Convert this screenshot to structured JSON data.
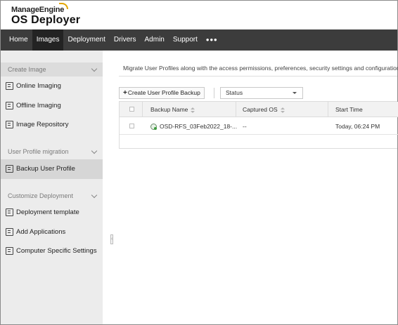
{
  "brand": {
    "company": "ManageEngine",
    "product": "OS Deployer",
    "accent": "#e2a500"
  },
  "nav": {
    "items": [
      {
        "label": "Home"
      },
      {
        "label": "Images"
      },
      {
        "label": "Deployment"
      },
      {
        "label": "Drivers"
      },
      {
        "label": "Admin"
      },
      {
        "label": "Support"
      }
    ],
    "active": "Images",
    "more": "•••"
  },
  "sidebar": {
    "groups": [
      {
        "label": "Create Image",
        "items": [
          {
            "label": "Online Imaging"
          },
          {
            "label": "Offline Imaging"
          },
          {
            "label": "Image Repository"
          }
        ]
      },
      {
        "label": "User Profile migration",
        "items": [
          {
            "label": "Backup User Profile"
          }
        ]
      },
      {
        "label": "Customize Deployment",
        "items": [
          {
            "label": "Deployment template"
          },
          {
            "label": "Add Applications"
          },
          {
            "label": "Computer Specific Settings"
          }
        ]
      }
    ],
    "active_item": "Backup User Profile"
  },
  "main": {
    "description": "Migrate User Profiles along with the access permissions, preferences, security settings and configurations",
    "add_button": "Create User Profile Backup",
    "add_button_icon": "+",
    "status_filter": "Status",
    "table": {
      "columns": [
        "Backup Name",
        "Captured OS",
        "Start Time"
      ],
      "rows": [
        {
          "backup_name": "OSD-RFS_03Feb2022_18-...",
          "captured_os": "--",
          "start_time": "Today, 06:24 PM"
        }
      ]
    }
  }
}
